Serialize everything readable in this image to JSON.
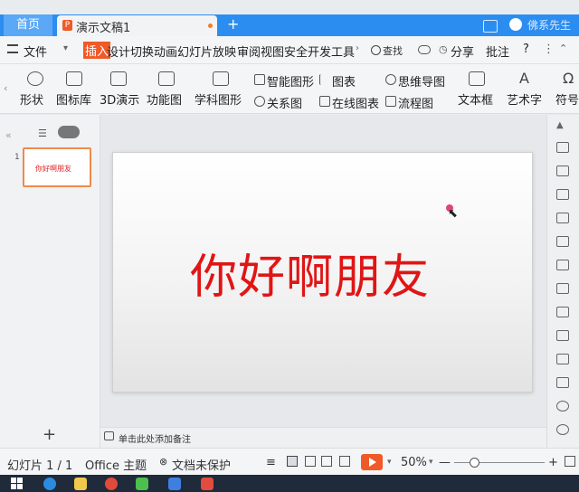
{
  "tabs": {
    "home": "首页",
    "document": "演示文稿1",
    "new_tab": "+"
  },
  "user": {
    "name": "佛系先生"
  },
  "menubar": {
    "file": "文件",
    "items": [
      "插入",
      "设计",
      "切换",
      "动画",
      "幻灯片放映",
      "审阅",
      "视图",
      "安全",
      "开发工具"
    ],
    "search": "查找",
    "share": "分享",
    "annotate": "批注",
    "help": "?"
  },
  "ribbon": {
    "shape": "形状",
    "icon_lib": "图标库",
    "d3": "3D演示",
    "func_chart": "功能图",
    "subject_chart": "学科图形",
    "smart_shape": "智能图形",
    "chart": "图表",
    "mind_map": "思维导图",
    "relation": "关系图",
    "online_chart": "在线图表",
    "flowchart": "流程图",
    "textbox": "文本框",
    "art_text": "艺术字",
    "symbol": "符号"
  },
  "slide_panel": {
    "slide_number": "1",
    "thumb_text": "你好啊朋友",
    "add": "+"
  },
  "slide": {
    "title": "你好啊朋友"
  },
  "notes": {
    "placeholder": "单击此处添加备注"
  },
  "status": {
    "slide_count": "幻灯片 1 / 1",
    "theme": "Office 主题",
    "protection": "文档未保护",
    "zoom": "50%",
    "zoom_minus": "—",
    "zoom_plus": "+"
  },
  "colors": {
    "accent": "#2c8df0",
    "active_menu": "#f05a28",
    "title_red": "#e01515"
  }
}
